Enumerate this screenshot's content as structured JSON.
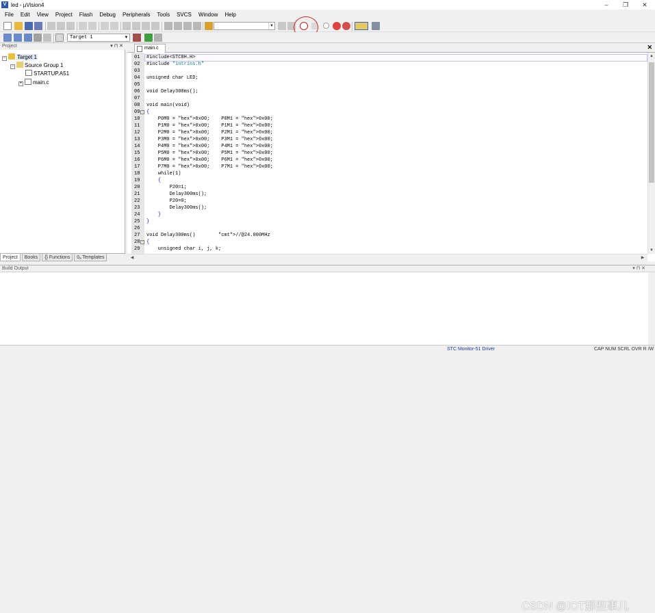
{
  "window": {
    "title": "led - µVision4",
    "app_icon": "uvision-icon"
  },
  "menu": [
    "File",
    "Edit",
    "View",
    "Project",
    "Flash",
    "Debug",
    "Peripherals",
    "Tools",
    "SVCS",
    "Window",
    "Help"
  ],
  "toolbar": {
    "find_value": "",
    "target_select": "Target 1"
  },
  "project_panel": {
    "title": "Project",
    "tree": [
      {
        "label": "Target 1",
        "level": 0,
        "expanded": true
      },
      {
        "label": "Source Group 1",
        "level": 1,
        "expanded": true
      },
      {
        "label": "STARTUP.A51",
        "level": 2
      },
      {
        "label": "main.c",
        "level": 2,
        "expandable": true
      }
    ],
    "tabs": [
      "Project",
      "Books",
      "{} Functions",
      "0ₐ Templates"
    ]
  },
  "editor": {
    "tab": "main.c",
    "lines": [
      "#include<STC8H.H>",
      "#include \"intrins.h\"",
      "",
      "unsigned char LED;",
      "",
      "void Delay300ms();",
      "",
      "void main(void)",
      "{",
      "    P0M0 = 0x00;    P0M1 = 0x00;",
      "    P1M0 = 0x00;    P1M1 = 0x00;",
      "    P2M0 = 0x00;    P2M1 = 0x00;",
      "    P3M0 = 0x00;    P3M1 = 0x00;",
      "    P4M0 = 0x00;    P4M1 = 0x00;",
      "    P5M0 = 0x00;    P5M1 = 0x00;",
      "    P6M0 = 0x00;    P6M1 = 0x00;",
      "    P7M0 = 0x00;    P7M1 = 0x00;",
      "    while(1)",
      "    {",
      "        P20=1;",
      "        Delay300ms();",
      "        P20=0;",
      "        Delay300ms();",
      "    }",
      "}",
      "",
      "void Delay300ms()        //@24.000MHz",
      "{",
      "    unsigned char i, j, k;"
    ],
    "line_numbers": [
      "01",
      "02",
      "03",
      "04",
      "05",
      "06",
      "07",
      "08",
      "09",
      "10",
      "11",
      "12",
      "13",
      "14",
      "15",
      "16",
      "17",
      "18",
      "19",
      "20",
      "21",
      "22",
      "23",
      "24",
      "25",
      "26",
      "27",
      "28",
      "29"
    ]
  },
  "build_output": {
    "title": "Build Output"
  },
  "status": {
    "driver": "STC Monitor-51 Driver",
    "indicators": "CAP  NUM  SCRL  OVR  R /W"
  },
  "watermark": "CSDN @IOT那些事儿"
}
